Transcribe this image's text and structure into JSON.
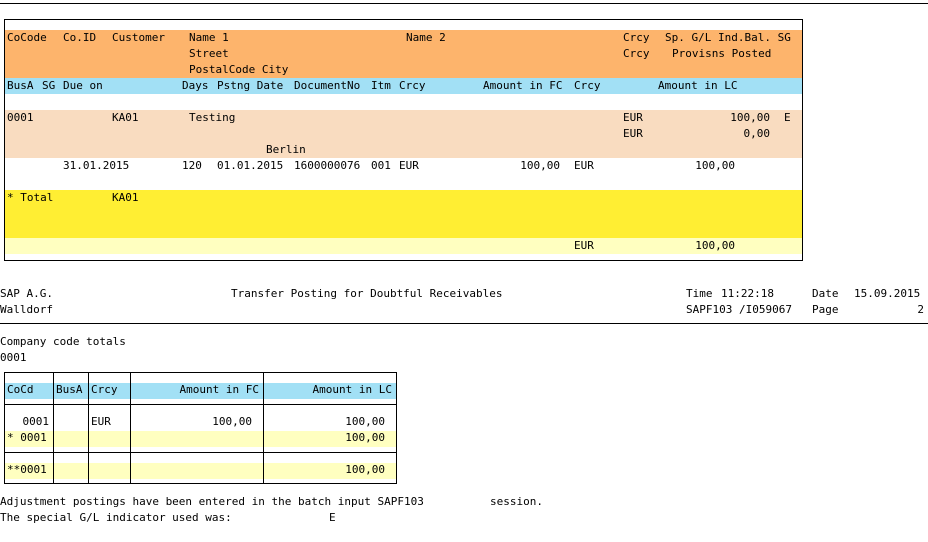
{
  "report": {
    "header": {
      "r1": {
        "cocode": "CoCode",
        "coid": "Co.ID",
        "customer": "Customer",
        "name1": "Name 1",
        "name2": "Name 2",
        "crcy": "Crcy",
        "spgl": "Sp. G/L Ind.Bal. SG"
      },
      "r2": {
        "street": "Street",
        "crcy": "Crcy",
        "provisions": "Provisns Posted"
      },
      "r3": {
        "postal": "PostalCode City"
      },
      "r4": {
        "busa": "BusA",
        "sg": "SG",
        "dueon": "Due on",
        "days": "Days",
        "pstng": "Pstng Date",
        "docno": "DocumentNo",
        "itm": "Itm",
        "crcy": "Crcy",
        "amtfc": "Amount in FC",
        "crcy2": "Crcy",
        "amtlc": "Amount in LC"
      }
    },
    "customer": {
      "cocode": "0001",
      "custno": "KA01",
      "name": "Testing",
      "crcy1": "EUR",
      "bal1": "100,00",
      "ind": "E",
      "crcy2": "EUR",
      "bal2": "0,00",
      "city": "Berlin"
    },
    "item": {
      "dueon": "31.01.2015",
      "days": "120",
      "pstng": "01.01.2015",
      "docno": "1600000076",
      "itm": "001",
      "crcy": "EUR",
      "amtfc": "100,00",
      "crcy2": "EUR",
      "amtlc": "100,00"
    },
    "total": {
      "label": "* Total",
      "custno": "KA01",
      "crcy": "EUR",
      "amtlc": "100,00"
    }
  },
  "page_header": {
    "company": "SAP A.G.",
    "city": "Walldorf",
    "title": "Transfer Posting for Doubtful Receivables",
    "time_label": "Time",
    "time": "11:22:18",
    "date_label": "Date",
    "date": "15.09.2015",
    "program": "SAPF103 /I059067",
    "page_label": "Page",
    "page": "2"
  },
  "company_totals": {
    "title": "Company code totals",
    "code": "0001",
    "headers": {
      "cocd": "CoCd",
      "busa": "BusA",
      "crcy": "Crcy",
      "amtfc": "Amount in FC",
      "amtlc": "Amount in LC"
    },
    "row1": {
      "cocd": "0001",
      "crcy": "EUR",
      "amtfc": "100,00",
      "amtlc": "100,00"
    },
    "row2": {
      "cocd": "* 0001",
      "amtlc": "100,00"
    },
    "row3": {
      "cocd": "**0001",
      "amtlc": "100,00"
    }
  },
  "footer": {
    "line1a": "Adjustment postings have been entered in the batch input SAPF103",
    "line1b": "session.",
    "line2a": "The special G/L indicator used was:",
    "line2b": "E"
  }
}
